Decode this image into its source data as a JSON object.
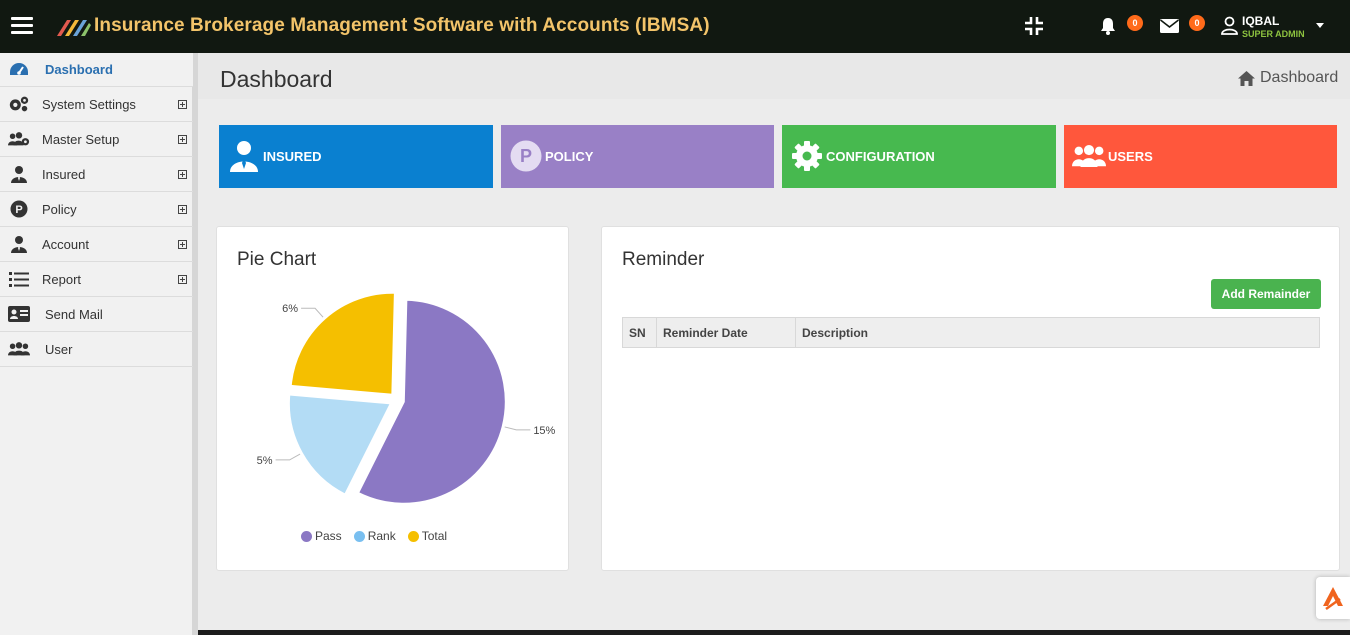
{
  "app": {
    "title": "Insurance Brokerage Management Software with Accounts (IBMSA)",
    "notifications_count": "0",
    "messages_count": "0",
    "user_name": "IQBAL",
    "user_role": "SUPER ADMIN"
  },
  "sidebar": {
    "items": [
      {
        "label": "Dashboard",
        "icon": "dashboard-gauge-icon",
        "expandable": false,
        "active": true
      },
      {
        "label": "System Settings",
        "icon": "gears-icon",
        "expandable": true
      },
      {
        "label": "Master Setup",
        "icon": "users-cog-icon",
        "expandable": true
      },
      {
        "label": "Insured",
        "icon": "user-tie-icon",
        "expandable": true
      },
      {
        "label": "Policy",
        "icon": "p-circle-icon",
        "expandable": true
      },
      {
        "label": "Account",
        "icon": "user-tie-icon",
        "expandable": true
      },
      {
        "label": "Report",
        "icon": "list-icon",
        "expandable": true
      },
      {
        "label": "Send Mail",
        "icon": "id-card-icon",
        "expandable": false
      },
      {
        "label": "User",
        "icon": "users-icon",
        "expandable": false
      }
    ]
  },
  "page": {
    "title": "Dashboard",
    "breadcrumb": "Dashboard"
  },
  "tiles": [
    {
      "label": "INSURED",
      "color": "#0a80d0",
      "icon": "user-tie-icon"
    },
    {
      "label": "POLICY",
      "color": "#9980c6",
      "icon": "p-circle-icon"
    },
    {
      "label": "CONFIGURATION",
      "color": "#47b94f",
      "icon": "gear-icon"
    },
    {
      "label": "USERS",
      "color": "#ff573c",
      "icon": "users-icon"
    }
  ],
  "pie_card": {
    "title": "Pie Chart"
  },
  "chart_data": {
    "type": "pie",
    "title": "Pie Chart",
    "slices": [
      {
        "name": "Pass",
        "value": 15,
        "label": "15%",
        "color": "#8b78c4",
        "share": 0.57
      },
      {
        "name": "Rank",
        "value": 5,
        "label": "5%",
        "color": "#b3dcf5",
        "share": 0.19
      },
      {
        "name": "Total",
        "value": 6,
        "label": "6%",
        "color": "#f5bf00",
        "share": 0.24
      }
    ],
    "legend": [
      "Pass",
      "Rank",
      "Total"
    ],
    "legend_placement": "bottom",
    "legend_colors": [
      "#8b78c4",
      "#79bff0",
      "#f5bf00"
    ]
  },
  "reminder": {
    "title": "Reminder",
    "add_button": "Add Remainder",
    "columns": [
      "SN",
      "Reminder Date",
      "Description"
    ],
    "rows": []
  }
}
